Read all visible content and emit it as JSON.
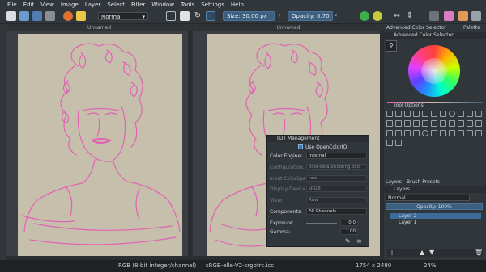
{
  "menu": [
    "File",
    "Edit",
    "View",
    "Image",
    "Layer",
    "Select",
    "Filter",
    "Window",
    "Tools",
    "Settings",
    "Help"
  ],
  "toolbar": {
    "blend_mode": "Normal",
    "size_label": "Size:",
    "size_value": "30.00 px",
    "opacity_label": "Opacity:",
    "opacity_value": "0.70"
  },
  "views": [
    {
      "title": "Unnamed"
    },
    {
      "title": "Unnamed"
    }
  ],
  "dock": {
    "tabs": [
      "Advanced Color Selector",
      "Palette"
    ],
    "color_selector_title": "Advanced Color Selector",
    "tool_options_label": "Tool Options",
    "layers_tabs": [
      "Layers",
      "Brush Presets"
    ],
    "layers_title": "Layers",
    "layers_blend": "Normal",
    "layers_opacity": "Opacity: 100%",
    "layers": [
      {
        "name": "Layer 2",
        "selected": true
      },
      {
        "name": "Layer 1",
        "selected": false
      }
    ]
  },
  "lut": {
    "title": "LUT Management",
    "use_opencolorio": "Use OpenColorIO",
    "color_engine_label": "Color Engine:",
    "color_engine_value": "Internal",
    "configuration_label": "Configuration:",
    "configuration_value": "ocio-default/config.ocio",
    "input_colorspace_label": "Input ColorSpace:",
    "input_colorspace_value": "raw",
    "display_device_label": "Display Device:",
    "display_device_value": "sRGB",
    "view_label": "View:",
    "view_value": "Raw",
    "components_label": "Components:",
    "components_value": "All Channels",
    "exposure_label": "Exposure:",
    "exposure_value": "0.0",
    "gamma_label": "Gamma:",
    "gamma_value": "1.00"
  },
  "status": {
    "color_model": "RGB (8-bit integer/channel)",
    "profile": "sRGB-elle-V2-srgbtrc.icc",
    "dimensions": "1754 x 2480",
    "zoom": "24%"
  },
  "colors": {
    "sketch": "#e45ab4",
    "paper": "#c6bfac",
    "accent": "#3d5f80"
  }
}
